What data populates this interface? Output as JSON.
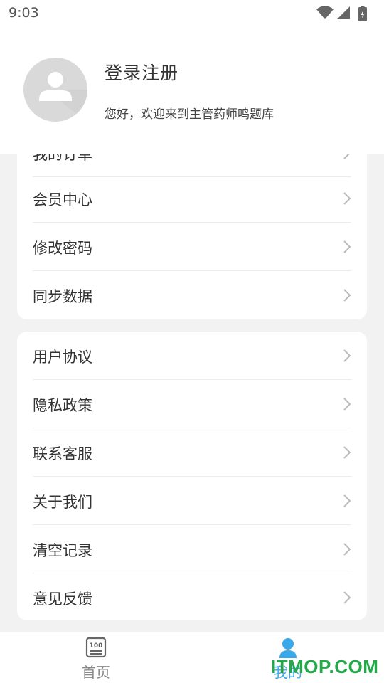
{
  "status_bar": {
    "time": "9:03"
  },
  "profile": {
    "title": "登录注册",
    "subtitle": "您好，欢迎来到主管药师鸣题库"
  },
  "menu_group_1": [
    {
      "label": "我的订单"
    },
    {
      "label": "会员中心"
    },
    {
      "label": "修改密码"
    },
    {
      "label": "同步数据"
    }
  ],
  "menu_group_2": [
    {
      "label": "用户协议"
    },
    {
      "label": "隐私政策"
    },
    {
      "label": "联系客服"
    },
    {
      "label": "关于我们"
    },
    {
      "label": "清空记录"
    },
    {
      "label": "意见反馈"
    }
  ],
  "bottom_nav": {
    "home_label": "首页",
    "home_icon_text": "100",
    "mine_label": "我的"
  },
  "watermark": "ITMOP.COM",
  "colors": {
    "accent": "#3aa8e8",
    "watermark": "#23a84a"
  }
}
